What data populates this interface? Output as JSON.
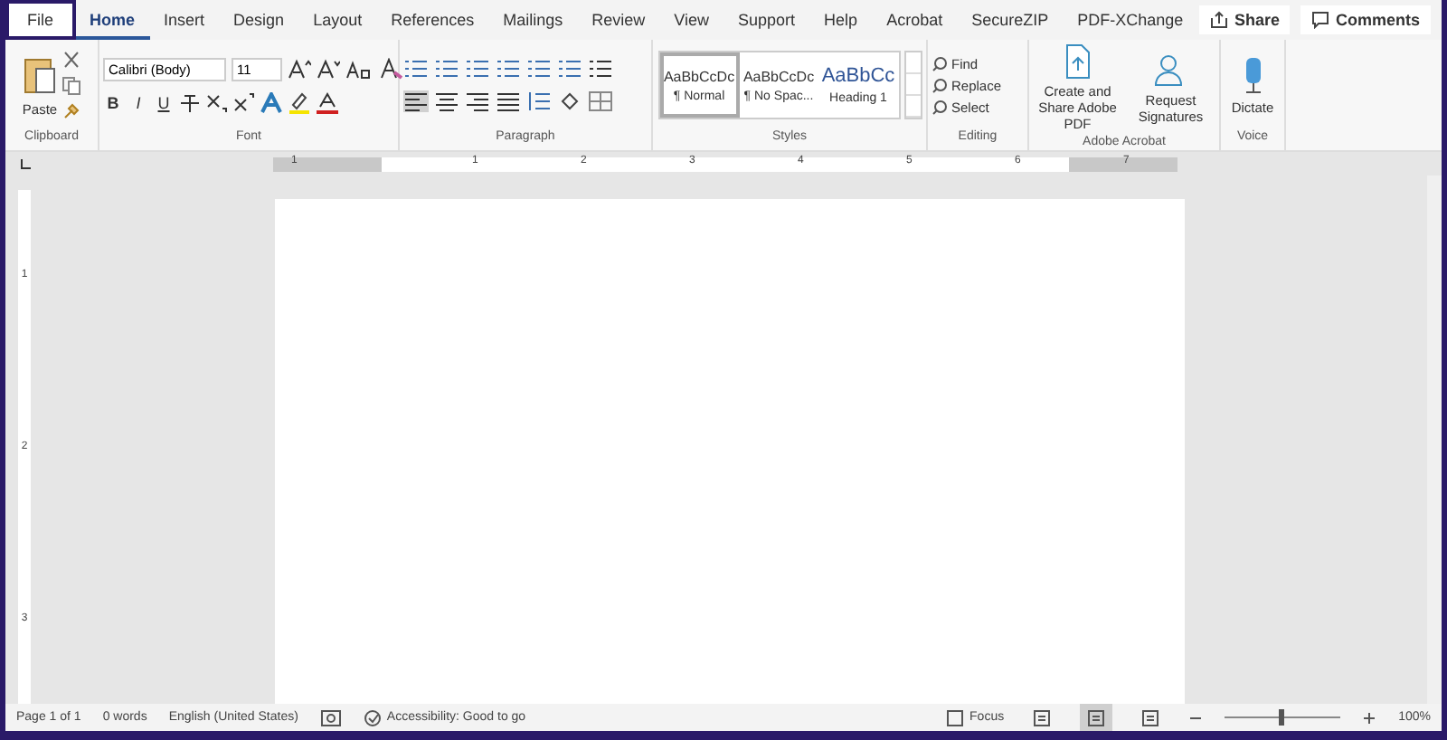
{
  "tabs": [
    {
      "label": "File",
      "selected": false,
      "kind": "file"
    },
    {
      "label": "Home",
      "selected": true,
      "kind": "tab"
    },
    {
      "label": "Insert",
      "selected": false,
      "kind": "tab"
    },
    {
      "label": "Design",
      "selected": false,
      "kind": "tab"
    },
    {
      "label": "Layout",
      "selected": false,
      "kind": "tab"
    },
    {
      "label": "References",
      "selected": false,
      "kind": "tab"
    },
    {
      "label": "Mailings",
      "selected": false,
      "kind": "tab"
    },
    {
      "label": "Review",
      "selected": false,
      "kind": "tab"
    },
    {
      "label": "View",
      "selected": false,
      "kind": "tab"
    },
    {
      "label": "Support",
      "selected": false,
      "kind": "tab"
    },
    {
      "label": "Help",
      "selected": false,
      "kind": "tab"
    },
    {
      "label": "Acrobat",
      "selected": false,
      "kind": "tab"
    },
    {
      "label": "SecureZIP",
      "selected": false,
      "kind": "tab"
    },
    {
      "label": "PDF-XChange",
      "selected": false,
      "kind": "tab"
    }
  ],
  "share": {
    "label": "Share"
  },
  "comments": {
    "label": "Comments"
  },
  "clipboard": {
    "paste": "Paste",
    "label": "Clipboard"
  },
  "font": {
    "name": "Calibri (Body)",
    "size": "11",
    "bold": "B",
    "italic": "I",
    "underline": "U",
    "label": "Font"
  },
  "paragraph": {
    "label": "Paragraph"
  },
  "styles": {
    "items": [
      {
        "preview": "AaBbCcDc",
        "name": "¶ Normal",
        "selected": true
      },
      {
        "preview": "AaBbCcDc",
        "name": "¶ No Spac...",
        "selected": false
      },
      {
        "preview": "AaBbCc",
        "name": "Heading 1",
        "selected": false
      }
    ],
    "label": "Styles"
  },
  "editing": {
    "items": [
      "Find",
      "Replace",
      "Select"
    ],
    "label": "Editing"
  },
  "adobe": {
    "items": [
      "Create and Share Adobe PDF",
      "Request Signatures"
    ],
    "label": "Adobe Acrobat"
  },
  "voice": {
    "dictate": "Dictate",
    "label": "Voice"
  },
  "ruler": {
    "labels": [
      "1",
      "1",
      "2",
      "3",
      "4",
      "5",
      "6",
      "7"
    ],
    "vertical_labels": [
      "1",
      "2",
      "3"
    ]
  },
  "status_bar": {
    "page": "Page 1 of 1",
    "words": "0 words",
    "language": "English (United States)",
    "accessibility": "Accessibility: Good to go",
    "focus": "Focus",
    "views": [
      {
        "selected": false
      },
      {
        "selected": true
      },
      {
        "selected": false
      }
    ],
    "zoom": "100%",
    "level": 0.5
  }
}
